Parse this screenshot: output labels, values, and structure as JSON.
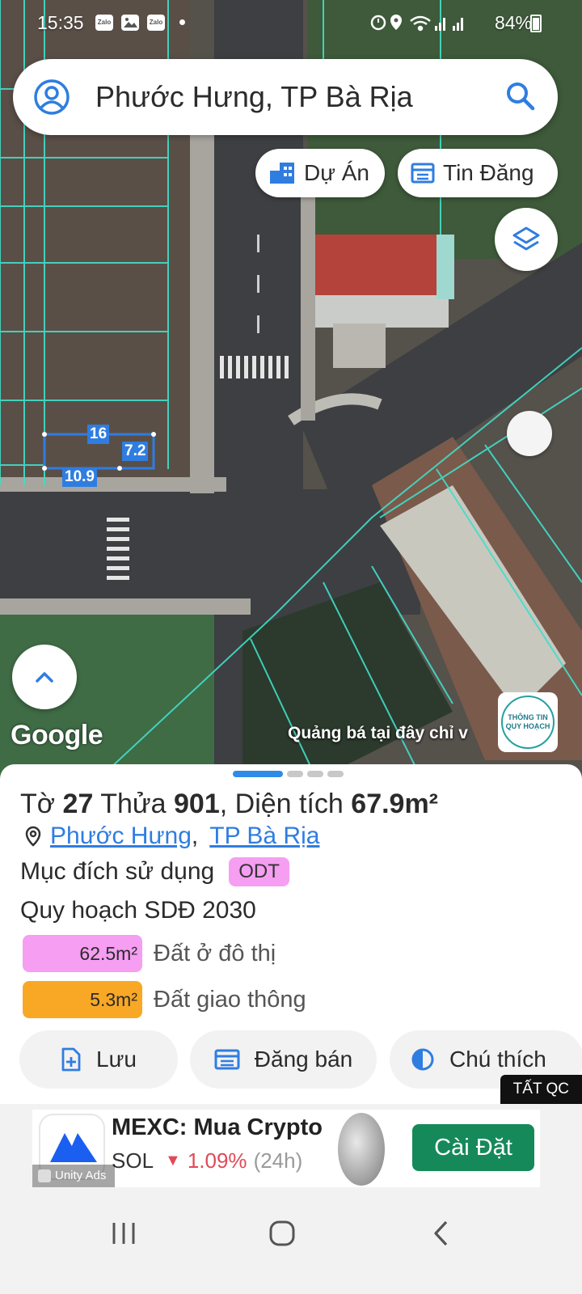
{
  "status": {
    "time": "15:35",
    "apps": [
      "Zalo",
      "Zalo"
    ],
    "battery": "84%",
    "icons": [
      "zalo-icon",
      "gallery-icon",
      "zalo-icon",
      "alarm-icon",
      "location-icon",
      "wifi-icon",
      "signal-icon",
      "signal-icon",
      "battery-icon"
    ]
  },
  "search": {
    "text": "Phước Hưng, TP Bà Rịa"
  },
  "chips": {
    "du_an": "Dự Án",
    "tin_dang": "Tin Đăng"
  },
  "map": {
    "dimensions": [
      "16",
      "7.2",
      "10.9"
    ],
    "google": "Google",
    "ad_text": "Quảng bá tại đây chỉ v",
    "badge_line1": "THÔNG TIN",
    "badge_line2": "QUY HOẠCH"
  },
  "parcel": {
    "to_label": "Tờ",
    "to_value": "27",
    "thua_label": "Thửa",
    "thua_value": "901",
    "area_label": ", Diện tích",
    "area_value": "67.9m²",
    "ward": "Phước Hưng",
    "city": "TP Bà Rịa",
    "purpose_label": "Mục đích sử dụng",
    "purpose_code": "ODT",
    "plan_label": "Quy hoạch SDĐ 2030",
    "zones": [
      {
        "area": "62.5m²",
        "label": "Đất ở đô thị",
        "color": "#f59ef2"
      },
      {
        "area": "5.3m²",
        "label": "Đất giao thông",
        "color": "#f9a826"
      }
    ]
  },
  "actions": {
    "save": "Lưu",
    "post_sale": "Đăng bán",
    "legend": "Chú thích"
  },
  "tat_qc": "TẤT QC",
  "ad": {
    "title": "MEXC: Mua Crypto",
    "symbol": "SOL",
    "change": "1.09%",
    "period": "(24h)",
    "install": "Cài Đặt",
    "network": "Unity Ads"
  }
}
